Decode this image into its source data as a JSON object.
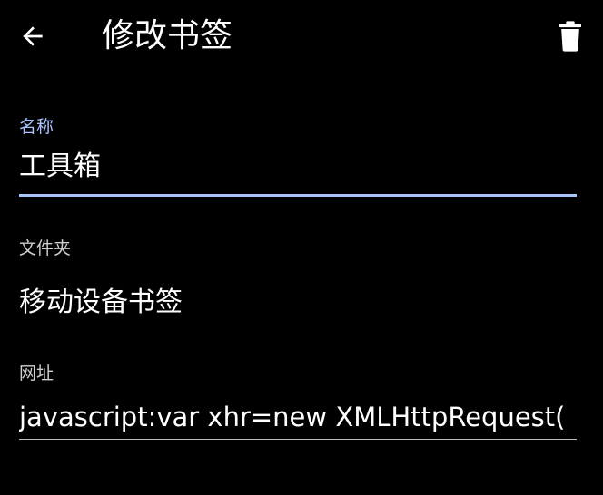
{
  "toolbar": {
    "back_icon": "arrow-left-icon",
    "title": "修改书签",
    "delete_icon": "trash-icon"
  },
  "fields": {
    "name": {
      "label": "名称",
      "value": "工具箱"
    },
    "folder": {
      "label": "文件夹",
      "value": "移动设备书签"
    },
    "url": {
      "label": "网址",
      "value": "javascript:var xhr=new XMLHttpRequest("
    }
  },
  "colors": {
    "background": "#000000",
    "accent": "#a8c4ff",
    "text": "#ffffff",
    "secondary_text": "#cfcfcf",
    "divider": "#bdbdbd"
  }
}
